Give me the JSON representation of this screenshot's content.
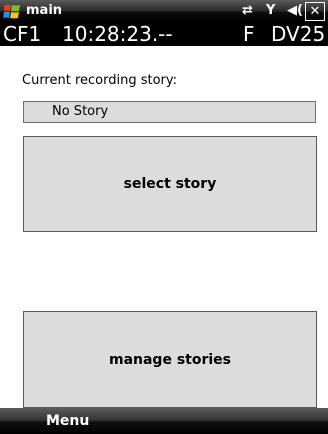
{
  "titlebar": {
    "title": "main",
    "icons": [
      "windows-logo",
      "connectivity-icon",
      "signal-icon",
      "volume-icon",
      "close-icon"
    ],
    "close_label": "✕"
  },
  "info_bar": {
    "card": "CF1",
    "time": "10:28:23.--",
    "mode": "F",
    "device": "DV25"
  },
  "recording": {
    "label": "Current recording story:",
    "story": "No Story"
  },
  "buttons": {
    "select_story": "select story",
    "manage_stories": "manage stories"
  },
  "menu": {
    "left": "Menu"
  },
  "colors": {
    "button_bg": "#dcdcdc",
    "bar_bg": "#000000",
    "text": "#000000"
  }
}
